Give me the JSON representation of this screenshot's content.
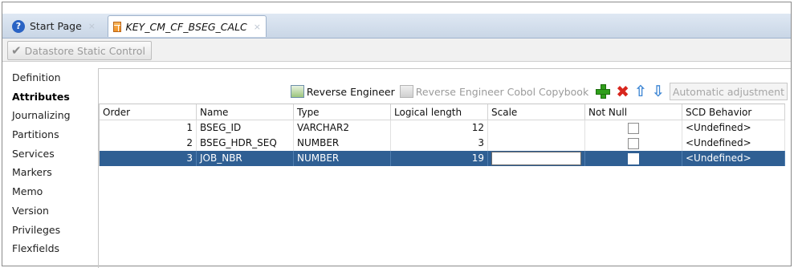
{
  "tabs": [
    {
      "label": "Start Page",
      "icon": "help-icon",
      "close": "×"
    },
    {
      "label": "KEY_CM_CF_BSEG_CALC",
      "icon": "table-icon",
      "close": "×",
      "active": true
    }
  ],
  "toolbar": {
    "datastore_static_control": "Datastore Static Control"
  },
  "sidebar": {
    "items": [
      {
        "label": "Definition",
        "active": false
      },
      {
        "label": "Attributes",
        "active": true
      },
      {
        "label": "Journalizing",
        "active": false
      },
      {
        "label": "Partitions",
        "active": false
      },
      {
        "label": "Services",
        "active": false
      },
      {
        "label": "Markers",
        "active": false
      },
      {
        "label": "Memo",
        "active": false
      },
      {
        "label": "Version",
        "active": false
      },
      {
        "label": "Privileges",
        "active": false
      },
      {
        "label": "Flexfields",
        "active": false
      }
    ]
  },
  "actions": {
    "reverse_engineer": "Reverse Engineer",
    "reverse_engineer_cobol": "Reverse Engineer Cobol Copybook",
    "automatic_adjustment": "Automatic adjustment"
  },
  "table": {
    "headers": [
      "Order",
      "Name",
      "Type",
      "Logical length",
      "Scale",
      "Not Null",
      "SCD Behavior"
    ],
    "rows": [
      {
        "order": "1",
        "name": "BSEG_ID",
        "type": "VARCHAR2",
        "length": "12",
        "scale": "",
        "not_null": false,
        "scd": "<Undefined>",
        "selected": false
      },
      {
        "order": "2",
        "name": "BSEG_HDR_SEQ",
        "type": "NUMBER",
        "length": "3",
        "scale": "",
        "not_null": false,
        "scd": "<Undefined>",
        "selected": false
      },
      {
        "order": "3",
        "name": "JOB_NBR",
        "type": "NUMBER",
        "length": "19",
        "scale": "",
        "not_null": false,
        "scd": "<Undefined>",
        "selected": true
      }
    ]
  },
  "colors": {
    "selection": "#2f5f93",
    "tabstrip": "#c9d6e6"
  }
}
